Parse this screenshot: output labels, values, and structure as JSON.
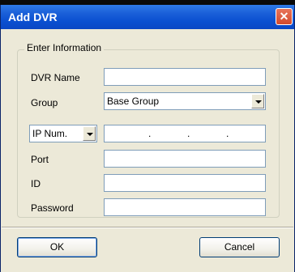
{
  "window": {
    "title": "Add DVR",
    "close_glyph": "✕"
  },
  "groupbox": {
    "label": "Enter Information"
  },
  "fields": {
    "dvr_name": {
      "label": "DVR Name",
      "value": ""
    },
    "group": {
      "label": "Group",
      "selected": "Base Group"
    },
    "ip_type": {
      "selected": "IP Num."
    },
    "ip_address": {
      "dots": [
        ".",
        ".",
        "."
      ]
    },
    "port": {
      "label": "Port",
      "value": ""
    },
    "id": {
      "label": "ID",
      "value": ""
    },
    "password": {
      "label": "Password",
      "value": ""
    }
  },
  "buttons": {
    "ok": "OK",
    "cancel": "Cancel"
  },
  "icons": {
    "close": "close-icon",
    "dropdown": "chevron-down-icon"
  },
  "colors": {
    "titlebar": "#0a4fd0",
    "close": "#d34a2c",
    "dialog_bg": "#ece9d8"
  }
}
